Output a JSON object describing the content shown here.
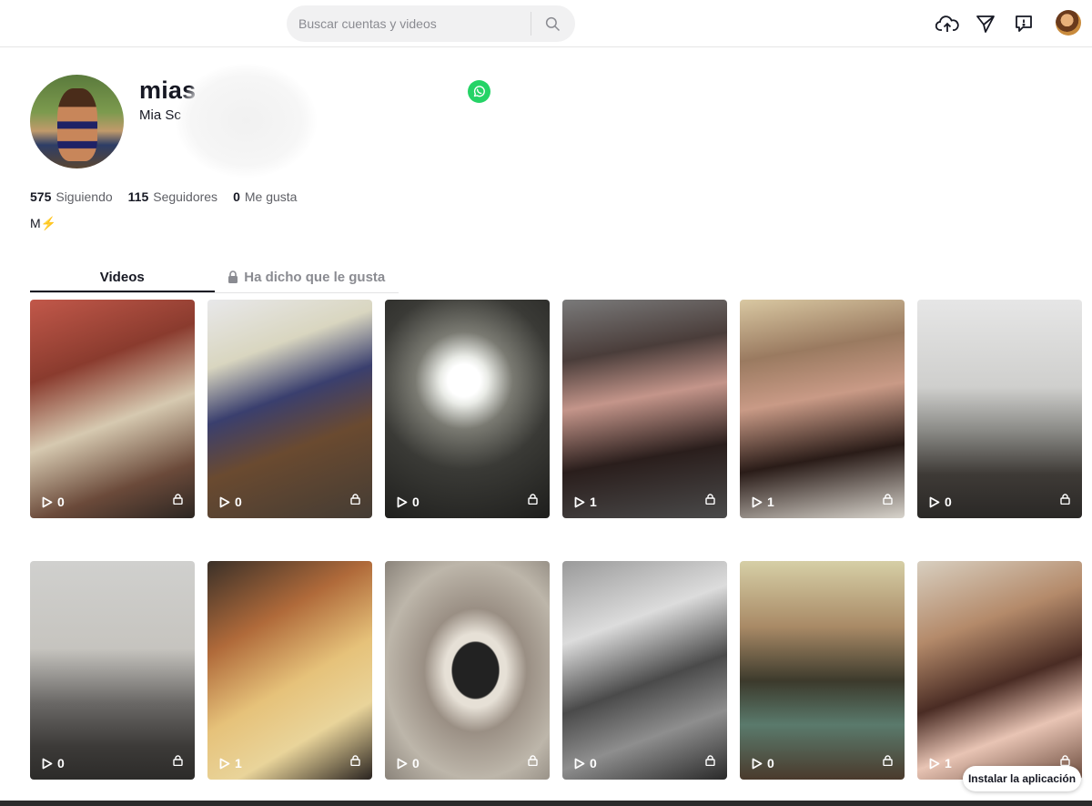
{
  "search": {
    "placeholder": "Buscar cuentas y videos"
  },
  "header": {
    "icons": [
      "upload-cloud-icon",
      "send-inbox-icon",
      "messages-icon",
      "user-avatar"
    ]
  },
  "profile": {
    "username": "mias",
    "nickname": "Mia Sc",
    "stats": {
      "following_count": "575",
      "following_label": "Siguiendo",
      "followers_count": "115",
      "followers_label": "Seguidores",
      "likes_count": "0",
      "likes_label": "Me gusta"
    },
    "bio": "M⚡"
  },
  "tabs": {
    "videos": "Videos",
    "liked": "Ha dicho que le gusta"
  },
  "videos": [
    {
      "views": "0",
      "bg": "linear-gradient(160deg,#c2584a 0%,#8a3b2e 30%,#d6c9b0 55%,#6b4a3a 80%,#2c2622 100%)"
    },
    {
      "views": "0",
      "bg": "linear-gradient(160deg,#e8e8ea 0%,#d9d6c0 25%,#3a3f6e 45%,#6a4a30 65%,#443c34 100%)"
    },
    {
      "views": "0",
      "bg": "radial-gradient(circle at 48% 37%,#ffffff 0 10%,#e9ebe6 15%,#7a7a72 30%,#3a3a36 55%,#1e1e1c 100%)"
    },
    {
      "views": "1",
      "bg": "linear-gradient(170deg,#7a7a7a 0%,#4a3d3a 25%,#c4958a 45%,#2a1e1c 70%,#4a4a4a 100%)"
    },
    {
      "views": "1",
      "bg": "linear-gradient(170deg,#d9c8a2 0%,#9a7a60 25%,#c99a86 45%,#2a1c18 70%,#d8d4cc 100%)"
    },
    {
      "views": "0",
      "bg": "linear-gradient(180deg,#e6e6e6 0%,#cfcfcd 40%,#8a8a86 60%,#3e3a36 80%,#2a2826 100%)"
    },
    {
      "views": "0",
      "bg": "linear-gradient(180deg,#d0d0ce 0%,#c6c4bf 40%,#6a6866 65%,#3c3a38 85%,#2c2b29 100%)"
    },
    {
      "views": "1",
      "bg": "linear-gradient(150deg,#3a3028 0%,#b06a3a 30%,#e6c27a 55%,#e9d49a 75%,#2a2420 100%)"
    },
    {
      "views": "0",
      "bg": "radial-gradient(ellipse at 55% 50%,#222 0 18%,#e6e0d6 19% 24%,#9a8f84 40%,#bdb6aa 70%,#8a837a 100%)"
    },
    {
      "views": "0",
      "bg": "linear-gradient(160deg,#9a9a9a 0%,#dcdcdc 30%,#4a4a4a 55%,#8e8e8e 75%,#2a2a2a 100%)"
    },
    {
      "views": "0",
      "bg": "linear-gradient(180deg,#d6cfa6 0%,#a98a66 30%,#3c3a2c 55%,#5a7a6c 75%,#4a3a2c 100%)"
    },
    {
      "views": "1",
      "bg": "linear-gradient(160deg,#d8cfc0 0%,#b48a6a 30%,#4a2c24 55%,#e8c4b4 75%,#6a4a3c 100%)"
    }
  ],
  "install": {
    "label": "Instalar la aplicación"
  },
  "colors": {
    "whatsapp": "#25d366",
    "text": "#161823",
    "muted": "#8a8b91"
  }
}
